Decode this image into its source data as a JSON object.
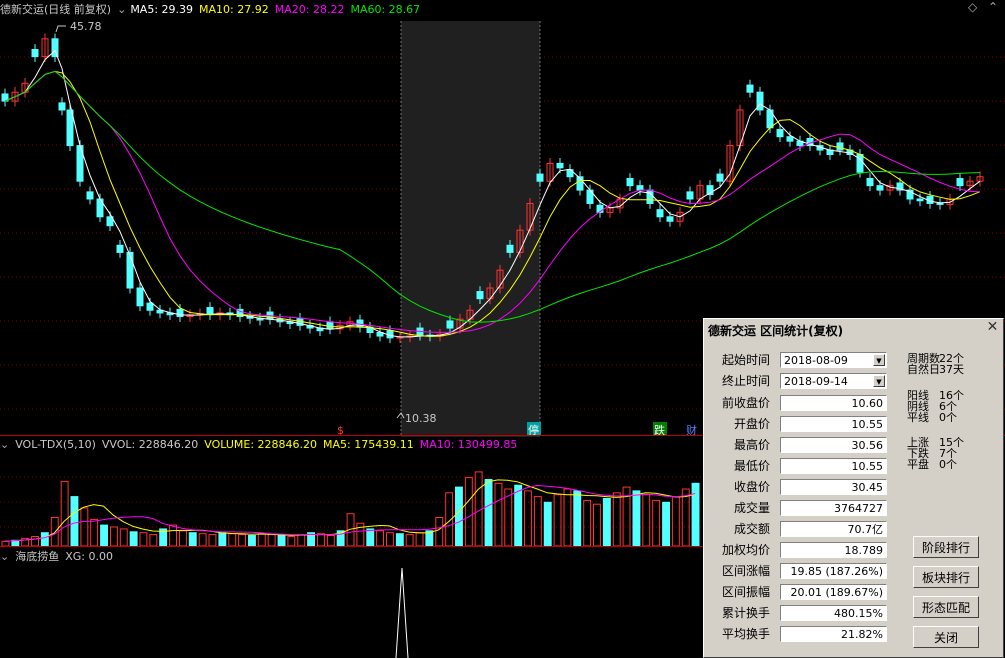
{
  "main_header": {
    "title": "德新交运(日线 前复权)",
    "ma5": "MA5: 29.39",
    "ma10": "MA10: 27.92",
    "ma20": "MA20: 28.22",
    "ma60": "MA60: 28.67"
  },
  "main_chart": {
    "high_label": "45.78",
    "low_label": "10.38",
    "markers": [
      "$",
      "停",
      "跌",
      "财"
    ]
  },
  "volume_header": {
    "title": "VOL-TDX(5,10)",
    "vvol": "VVOL: 228846.20",
    "volume": "VOLUME: 228846.20",
    "ma5": "MA5: 175439.11",
    "ma10": "MA10: 130499.85"
  },
  "indicator_header": {
    "title": "海底捞鱼",
    "xg": "XG: 0.00"
  },
  "dialog": {
    "title": "德新交运 区间统计(复权)",
    "start_label": "起始时间",
    "start_value": "2018-08-09",
    "end_label": "终止时间",
    "end_value": "2018-09-14",
    "fields": [
      {
        "label": "前收盘价",
        "value": "10.60"
      },
      {
        "label": "开盘价",
        "value": "10.55"
      },
      {
        "label": "最高价",
        "value": "30.56"
      },
      {
        "label": "最低价",
        "value": "10.55"
      },
      {
        "label": "收盘价",
        "value": "30.45"
      },
      {
        "label": "成交量",
        "value": "3764727"
      },
      {
        "label": "成交额",
        "value": "70.7亿"
      },
      {
        "label": "加权均价",
        "value": "18.789"
      },
      {
        "label": "区间涨幅",
        "value": "19.85 (187.26%)"
      },
      {
        "label": "区间振幅",
        "value": "20.01 (189.67%)"
      },
      {
        "label": "累计换手",
        "value": "480.15%"
      },
      {
        "label": "平均换手",
        "value": "21.82%"
      }
    ],
    "stats": [
      {
        "label": "周期数",
        "value": "22个"
      },
      {
        "label": "自然日",
        "value": "37天"
      },
      {
        "label": "阳线",
        "value": "16个"
      },
      {
        "label": "阴线",
        "value": "6个"
      },
      {
        "label": "平线",
        "value": "0个"
      },
      {
        "label": "上涨",
        "value": "15个"
      },
      {
        "label": "下跌",
        "value": "7个"
      },
      {
        "label": "平盘",
        "value": "0个"
      }
    ],
    "buttons": [
      "阶段排行",
      "板块排行",
      "形态匹配",
      "关闭"
    ]
  },
  "colors": {
    "up": "#ff3232",
    "down": "#54ffff",
    "ma5": "#ffffff",
    "ma10": "#ffff00",
    "ma20": "#ff00ff",
    "ma60": "#00e600",
    "grid": "#7a0000"
  }
}
